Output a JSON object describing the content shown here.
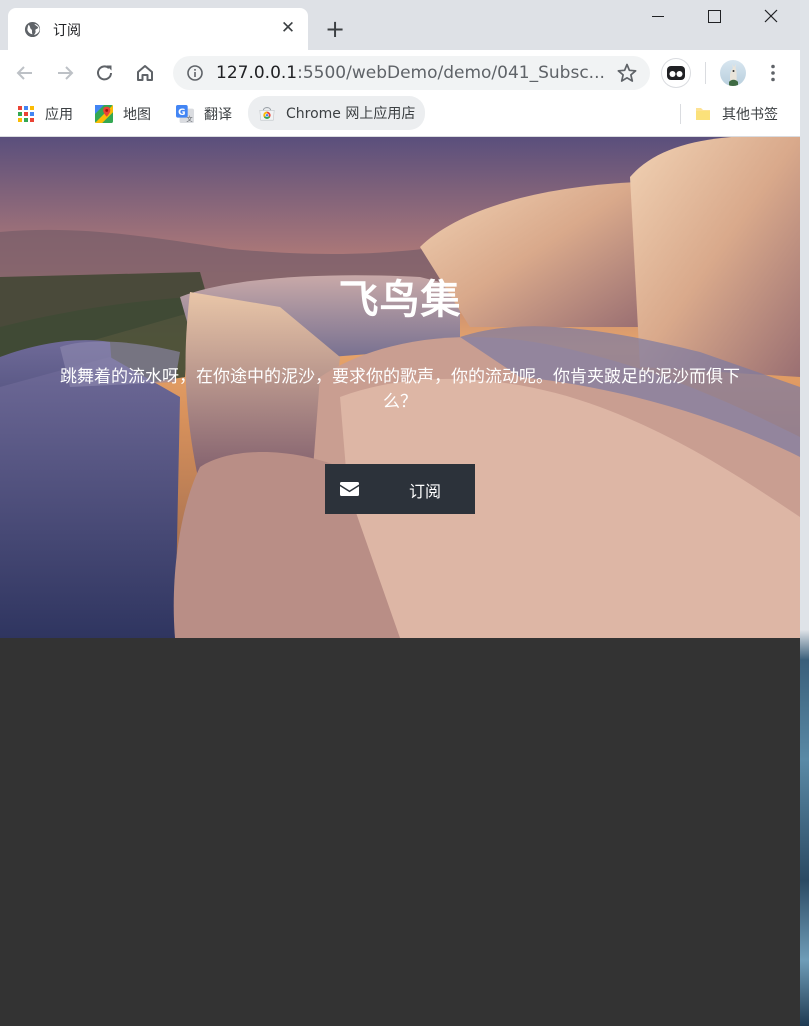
{
  "browser": {
    "tab": {
      "title": "订阅",
      "favicon": "globe-icon"
    },
    "new_tab_label": "+",
    "address": {
      "host": "127.0.0.1",
      "path": ":5500/webDemo/demo/041_Subsc..."
    },
    "bookmarks": [
      {
        "label": "应用",
        "icon": "apps-grid-icon"
      },
      {
        "label": "地图",
        "icon": "maps-icon"
      },
      {
        "label": "翻译",
        "icon": "translate-icon"
      },
      {
        "label": "Chrome 网上应用店",
        "icon": "chrome-webstore-icon"
      }
    ],
    "other_bookmarks": "其他书签"
  },
  "page": {
    "title": "飞鸟集",
    "text": "跳舞着的流水呀，在你途中的泥沙，要求你的歌声，你的流动呢。你肯夹跛足的泥沙而俱下么？",
    "subscribe_button": "订阅"
  },
  "colors": {
    "page_background": "#333333",
    "button_background": "#2c323a",
    "tabstrip": "#dee1e6"
  }
}
